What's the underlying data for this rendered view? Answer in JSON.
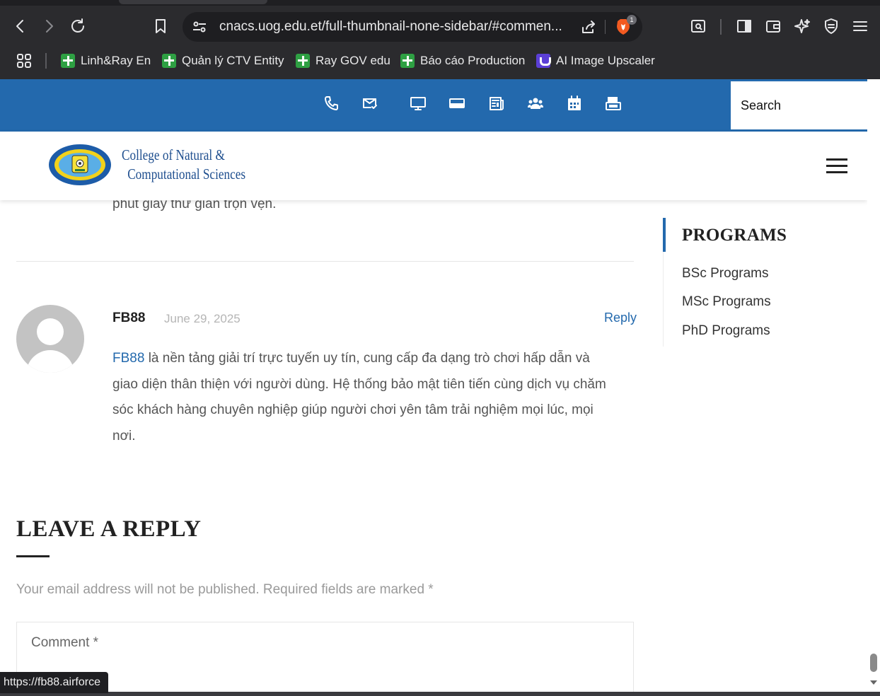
{
  "browser": {
    "url": "cnacs.uog.edu.et/full-thumbnail-none-sidebar/#commen...",
    "brave_badge": "1",
    "bookmarks": [
      {
        "label": "Linh&Ray En",
        "icon": "green-plus-icon"
      },
      {
        "label": "Quản lý CTV Entity",
        "icon": "green-plus-icon"
      },
      {
        "label": "Ray GOV edu",
        "icon": "green-plus-icon"
      },
      {
        "label": "Báo cáo Production",
        "icon": "green-plus-icon"
      },
      {
        "label": "AI Image Upscaler",
        "icon": "upscaler-icon"
      }
    ],
    "status_url": "https://fb88.airforce"
  },
  "topbar": {
    "icons": [
      "phone-icon",
      "mail-icon",
      "monitor-icon",
      "card-icon",
      "news-icon",
      "users-icon",
      "calendar-icon",
      "forms-icon"
    ],
    "search_placeholder": "Search"
  },
  "header": {
    "logo_line1": "College of Natural &",
    "logo_line2": "Computational Sciences"
  },
  "content": {
    "prev_comment_tail": "phút giây thư giãn trọn vẹn.",
    "comment": {
      "author": "FB88",
      "date": "June 29, 2025",
      "reply_label": "Reply",
      "link_text": "FB88",
      "body_rest": " là nền tảng giải trí trực tuyến uy tín, cung cấp đa dạng trò chơi hấp dẫn và giao diện thân thiện với người dùng. Hệ thống bảo mật tiên tiến cùng dịch vụ chăm sóc khách hàng chuyên nghiệp giúp người chơi yên tâm trải nghiệm mọi lúc, mọi nơi."
    },
    "leave_reply": {
      "title": "LEAVE A REPLY",
      "notes": "Your email address will not be published. Required fields are marked *",
      "comment_placeholder": "Comment *"
    }
  },
  "sidebar": {
    "title": "PROGRAMS",
    "items": [
      "BSc Programs",
      "MSc Programs",
      "PhD Programs"
    ]
  },
  "colors": {
    "brand_blue": "#2369ad",
    "chrome_bg": "#2b2b2e"
  }
}
